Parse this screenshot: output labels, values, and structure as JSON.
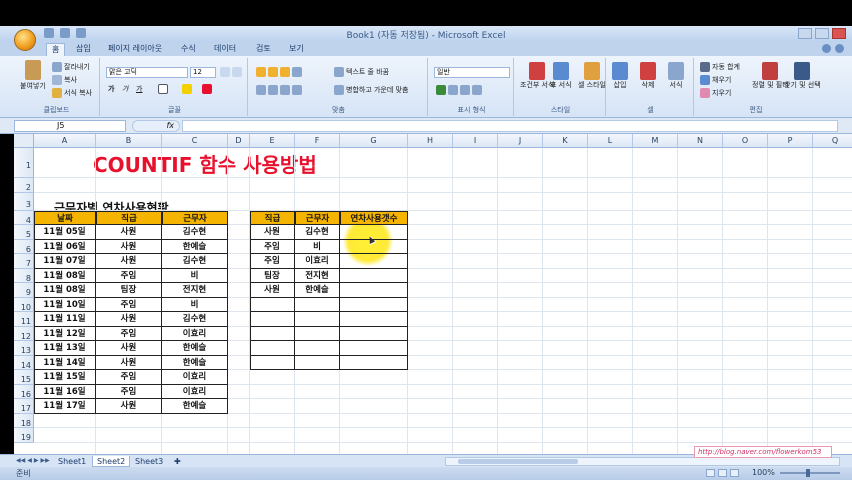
{
  "window": {
    "title": "Book1 (자동 저장됨) - Microsoft Excel"
  },
  "ribbon_tabs": [
    "홈",
    "삽입",
    "페이지 레이아웃",
    "수식",
    "데이터",
    "검토",
    "보기"
  ],
  "ribbon": {
    "clipboard": {
      "paste": "붙여넣기",
      "cut": "잘라내기",
      "copy": "복사",
      "format_painter": "서식 복사",
      "label": "클립보드"
    },
    "font": {
      "name": "맑은 고딕",
      "size": "12",
      "label": "글꼴",
      "bold": "가",
      "italic": "가",
      "underline": "가"
    },
    "alignment": {
      "wrap": "텍스트 줄 바꿈",
      "merge": "병합하고 가운데 맞춤",
      "label": "맞춤"
    },
    "number": {
      "format": "일반",
      "label": "표시 형식"
    },
    "styles": {
      "conditional": "조건부 서식",
      "table": "표 서식",
      "cell": "셀 스타일",
      "label": "스타일"
    },
    "cells": {
      "insert": "삽입",
      "delete": "삭제",
      "format": "서식",
      "label": "셀"
    },
    "editing": {
      "autosum": "자동 합계",
      "fill": "채우기",
      "clear": "지우기",
      "sort": "정렬 및 필터",
      "find": "찾기 및 선택",
      "label": "편집"
    }
  },
  "formula_bar": {
    "name_box": "J5",
    "fx": "fx",
    "value": ""
  },
  "columns": [
    "A",
    "B",
    "C",
    "D",
    "E",
    "F",
    "G",
    "H",
    "I",
    "J",
    "K",
    "L",
    "M",
    "N",
    "O",
    "P",
    "Q"
  ],
  "rows": [
    "1",
    "2",
    "3",
    "4",
    "5",
    "6",
    "7",
    "8",
    "9",
    "10",
    "11",
    "12",
    "13",
    "14",
    "15",
    "16",
    "17",
    "18",
    "19"
  ],
  "sheet": {
    "title": "COUNTIF 함수 사용방법",
    "subtitle": "근무자별 연차사용현황",
    "table1": {
      "headers": [
        "날짜",
        "직급",
        "근무자"
      ],
      "rows": [
        [
          "11월 05일",
          "사원",
          "김수현"
        ],
        [
          "11월 06일",
          "사원",
          "한예슬"
        ],
        [
          "11월 07일",
          "사원",
          "김수현"
        ],
        [
          "11월 08일",
          "주임",
          "비"
        ],
        [
          "11월 08일",
          "팀장",
          "전지현"
        ],
        [
          "11월 10일",
          "주임",
          "비"
        ],
        [
          "11월 11일",
          "사원",
          "김수현"
        ],
        [
          "11월 12일",
          "주임",
          "이효리"
        ],
        [
          "11월 13일",
          "사원",
          "한예슬"
        ],
        [
          "11월 14일",
          "사원",
          "한예슬"
        ],
        [
          "11월 15일",
          "주임",
          "이효리"
        ],
        [
          "11월 16일",
          "주임",
          "이효리"
        ],
        [
          "11월 17일",
          "사원",
          "한예슬"
        ]
      ]
    },
    "table2": {
      "headers": [
        "직급",
        "근무자",
        "연차사용갯수"
      ],
      "rows": [
        [
          "사원",
          "김수현",
          ""
        ],
        [
          "주임",
          "비",
          ""
        ],
        [
          "주임",
          "이효리",
          ""
        ],
        [
          "팀장",
          "전지현",
          ""
        ],
        [
          "사원",
          "한예슬",
          ""
        ],
        [
          "",
          "",
          ""
        ],
        [
          "",
          "",
          ""
        ],
        [
          "",
          "",
          ""
        ],
        [
          "",
          "",
          ""
        ],
        [
          "",
          "",
          ""
        ]
      ]
    }
  },
  "sheet_tabs": [
    "Sheet1",
    "Sheet2",
    "Sheet3"
  ],
  "active_sheet": "Sheet2",
  "watermark": "http://blog.naver.com/flowerkom53",
  "status": {
    "ready": "준비",
    "zoom": "100%"
  }
}
